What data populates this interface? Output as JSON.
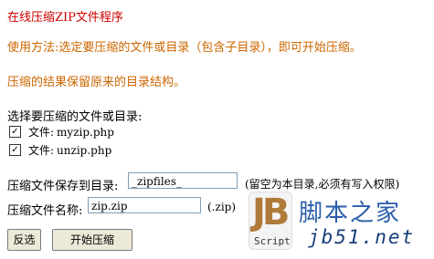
{
  "title": "在线压缩ZIP文件程序",
  "usage": "使用方法:选定要压缩的文件或目录（包含子目录），即可开始压缩。",
  "result_note": "压缩的结果保留原来的目录结构。",
  "choose_label": "选择要压缩的文件或目录:",
  "files": [
    {
      "prefix": "文件:",
      "name": "myzip.php",
      "checked": true
    },
    {
      "prefix": "文件:",
      "name": "unzip.php",
      "checked": true
    }
  ],
  "save_dir": {
    "label": "压缩文件保存到目录:",
    "value": "_zipfiles_",
    "note": "(留空为本目录,必须有写入权限)"
  },
  "zip_name": {
    "label": "压缩文件名称:",
    "value": "zip.zip",
    "ext": "(.zip)"
  },
  "buttons": {
    "invert": "反选",
    "start": "开始压缩"
  },
  "watermark": {
    "logo": "JB",
    "script": "Script",
    "name": "脚本之家",
    "url": "jb51.net"
  },
  "colors": {
    "title": "#cc0000",
    "instructions": "#cc6600"
  }
}
